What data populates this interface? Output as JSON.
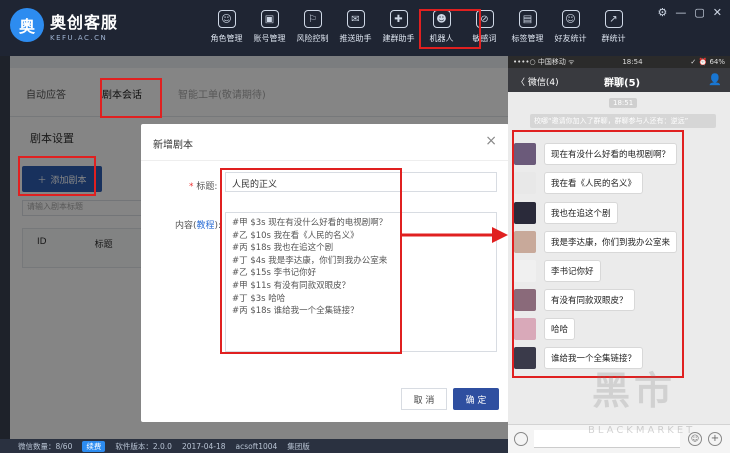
{
  "brand": {
    "mark": "奥",
    "title": "奥创客服",
    "subtitle": "KEFU.AC.CN"
  },
  "nav": [
    {
      "label": "角色管理",
      "icon": "user-icon",
      "glyph": "☺"
    },
    {
      "label": "账号管理",
      "icon": "account-icon",
      "glyph": "▣"
    },
    {
      "label": "风险控制",
      "icon": "shield-icon",
      "glyph": "⚐"
    },
    {
      "label": "推送助手",
      "icon": "push-icon",
      "glyph": "✉"
    },
    {
      "label": "建群助手",
      "icon": "group-icon",
      "glyph": "✚"
    },
    {
      "label": "机器人",
      "icon": "robot-icon",
      "glyph": "☻"
    },
    {
      "label": "敏感词",
      "icon": "block-icon",
      "glyph": "⊘"
    },
    {
      "label": "标签管理",
      "icon": "tag-icon",
      "glyph": "▤"
    },
    {
      "label": "好友统计",
      "icon": "friend-icon",
      "glyph": "☺"
    },
    {
      "label": "群统计",
      "icon": "chart-icon",
      "glyph": "↗"
    }
  ],
  "window_controls": [
    "⚙",
    "—",
    "▢",
    "✕"
  ],
  "tabs": [
    "自动应答",
    "剧本会话",
    "智能工单(敬请期待)"
  ],
  "section_title": "剧本设置",
  "add_button": "添加剧本",
  "search_placeholder": "请输入剧本标题",
  "table_headers": [
    "ID",
    "标题"
  ],
  "modal": {
    "title": "新增剧本",
    "title_label": "标题:",
    "title_value": "人民的正义",
    "content_label": "内容",
    "content_link": "教程",
    "content_lines": [
      "#甲 $3s 现在有没什么好看的电视剧啊？",
      "#乙 $10s 我在看《人民的名义》",
      "#丙 $18s 我也在追这个剧",
      "#丁 $4s 我是李达康，你们到我办公室来",
      "#乙 $15s 李书记你好",
      "#甲 $11s 有没有同款双眼皮？",
      "#丁 $3s 哈哈",
      "#丙 $18s 谁给我一个全集链接？"
    ],
    "cancel": "取 消",
    "confirm": "确 定"
  },
  "status_bar": [
    "微信数量：8/60",
    "续费",
    "软件版本：2.0.0",
    "2017-04-18",
    "acsoft1004",
    "集团版"
  ],
  "phone": {
    "status_left": "••••○ 中国移动 ᯤ",
    "status_time": "18:54",
    "status_right": "✓ ⏰ 64%",
    "back": "〈 微信(4)",
    "chat_title": "群聊(5)",
    "time": "18:51",
    "system_msg": "校哪“邀请你加入了群聊，群聊参与人还有：逆远”",
    "messages": [
      {
        "text": "现在有没什么好看的电视剧啊？",
        "avatar_color": "#6b5a7a"
      },
      {
        "text": "我在看《人民的名义》",
        "avatar_color": "#e8e8e8"
      },
      {
        "text": "我也在追这个剧",
        "avatar_color": "#2a2a3a"
      },
      {
        "text": "我是李达康，你们到我办公室来",
        "avatar_color": "#c8a99a"
      },
      {
        "text": "李书记你好",
        "avatar_color": "#f0f0f0"
      },
      {
        "text": "有没有同款双眼皮？",
        "avatar_color": "#8a6a7a"
      },
      {
        "text": "哈哈",
        "avatar_color": "#d9a9b9"
      },
      {
        "text": "谁给我一个全集链接？",
        "avatar_color": "#3a3a4a"
      }
    ]
  },
  "watermark": {
    "big": "黑市",
    "small": "BLACKMARKET"
  }
}
